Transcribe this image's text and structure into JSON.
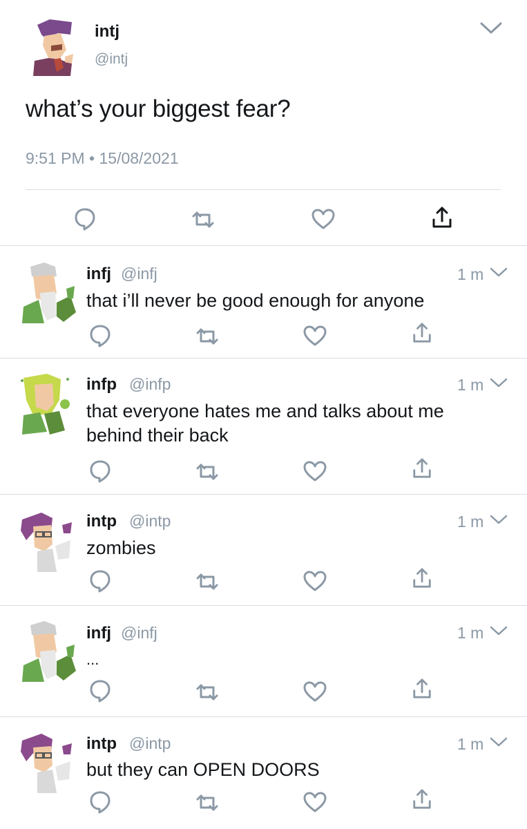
{
  "main_tweet": {
    "name": "intj",
    "handle": "@intj",
    "text": "what’s your biggest fear?",
    "meta": "9:51 PM • 15/08/2021"
  },
  "replies": [
    {
      "name": "infj",
      "handle": "@infj",
      "time": "1 m",
      "text": "that i’ll never be good enough for anyone",
      "avatar": "infj-avatar"
    },
    {
      "name": "infp",
      "handle": "@infp",
      "time": "1 m",
      "text": "that everyone hates me and talks about me behind their back",
      "avatar": "infp-avatar"
    },
    {
      "name": "intp",
      "handle": "@intp",
      "time": "1 m",
      "text": "zombies",
      "avatar": "intp-avatar"
    },
    {
      "name": "infj",
      "handle": "@infj",
      "time": "1 m",
      "text": "...",
      "avatar": "infj-avatar"
    },
    {
      "name": "intp",
      "handle": "@intp",
      "time": "1 m",
      "text": "but they can OPEN DOORS",
      "avatar": "intp-avatar"
    }
  ],
  "colors": {
    "icon_gray": "#8b98a5",
    "divider": "#d9dde1",
    "text": "#14171a"
  },
  "icons": [
    "reply-icon",
    "retweet-icon",
    "like-icon",
    "share-icon",
    "chevron-down-icon"
  ]
}
